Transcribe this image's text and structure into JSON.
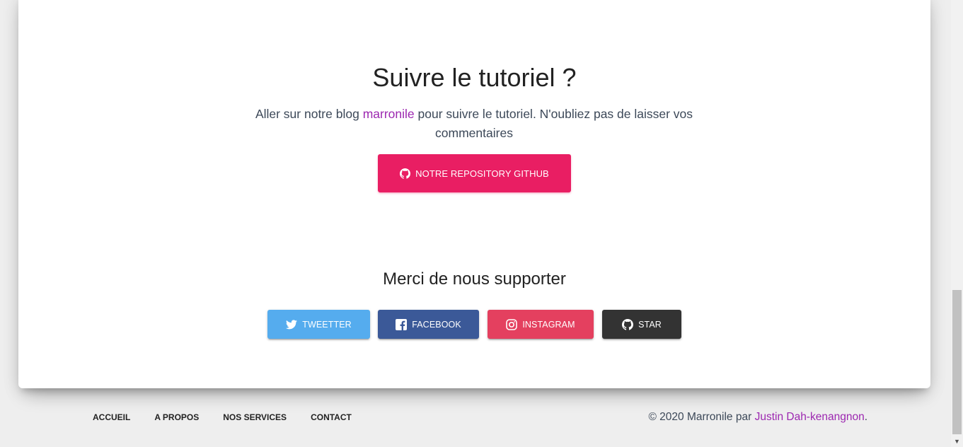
{
  "main": {
    "title": "Suivre le tutoriel ?",
    "desc_before": "Aller sur notre blog ",
    "desc_link": "marronile",
    "desc_after": " pour suivre le tutoriel. N'oubliez pas de laisser vos commentaires",
    "github_button_label": "NOTRE REPOSITORY GITHUB",
    "github_icon": "github-icon"
  },
  "support": {
    "title": "Merci de nous supporter",
    "buttons": [
      {
        "label": "TWEETTER",
        "icon": "twitter-icon",
        "color": "#55acee"
      },
      {
        "label": "FACEBOOK",
        "icon": "facebook-icon",
        "color": "#3b5998"
      },
      {
        "label": "INSTAGRAM",
        "icon": "instagram-icon",
        "color": "#e4405f"
      },
      {
        "label": "STAR",
        "icon": "github-icon",
        "color": "#333333"
      }
    ]
  },
  "footer": {
    "nav": [
      "ACCUEIL",
      "A PROPOS",
      "NOS SERVICES",
      "CONTACT"
    ],
    "copyright_prefix": "© 2020 Marronile par ",
    "copyright_author": "Justin Dah-kenangnon",
    "copyright_suffix": "."
  },
  "colors": {
    "accent": "#e91e63",
    "link": "#9c27b0"
  }
}
